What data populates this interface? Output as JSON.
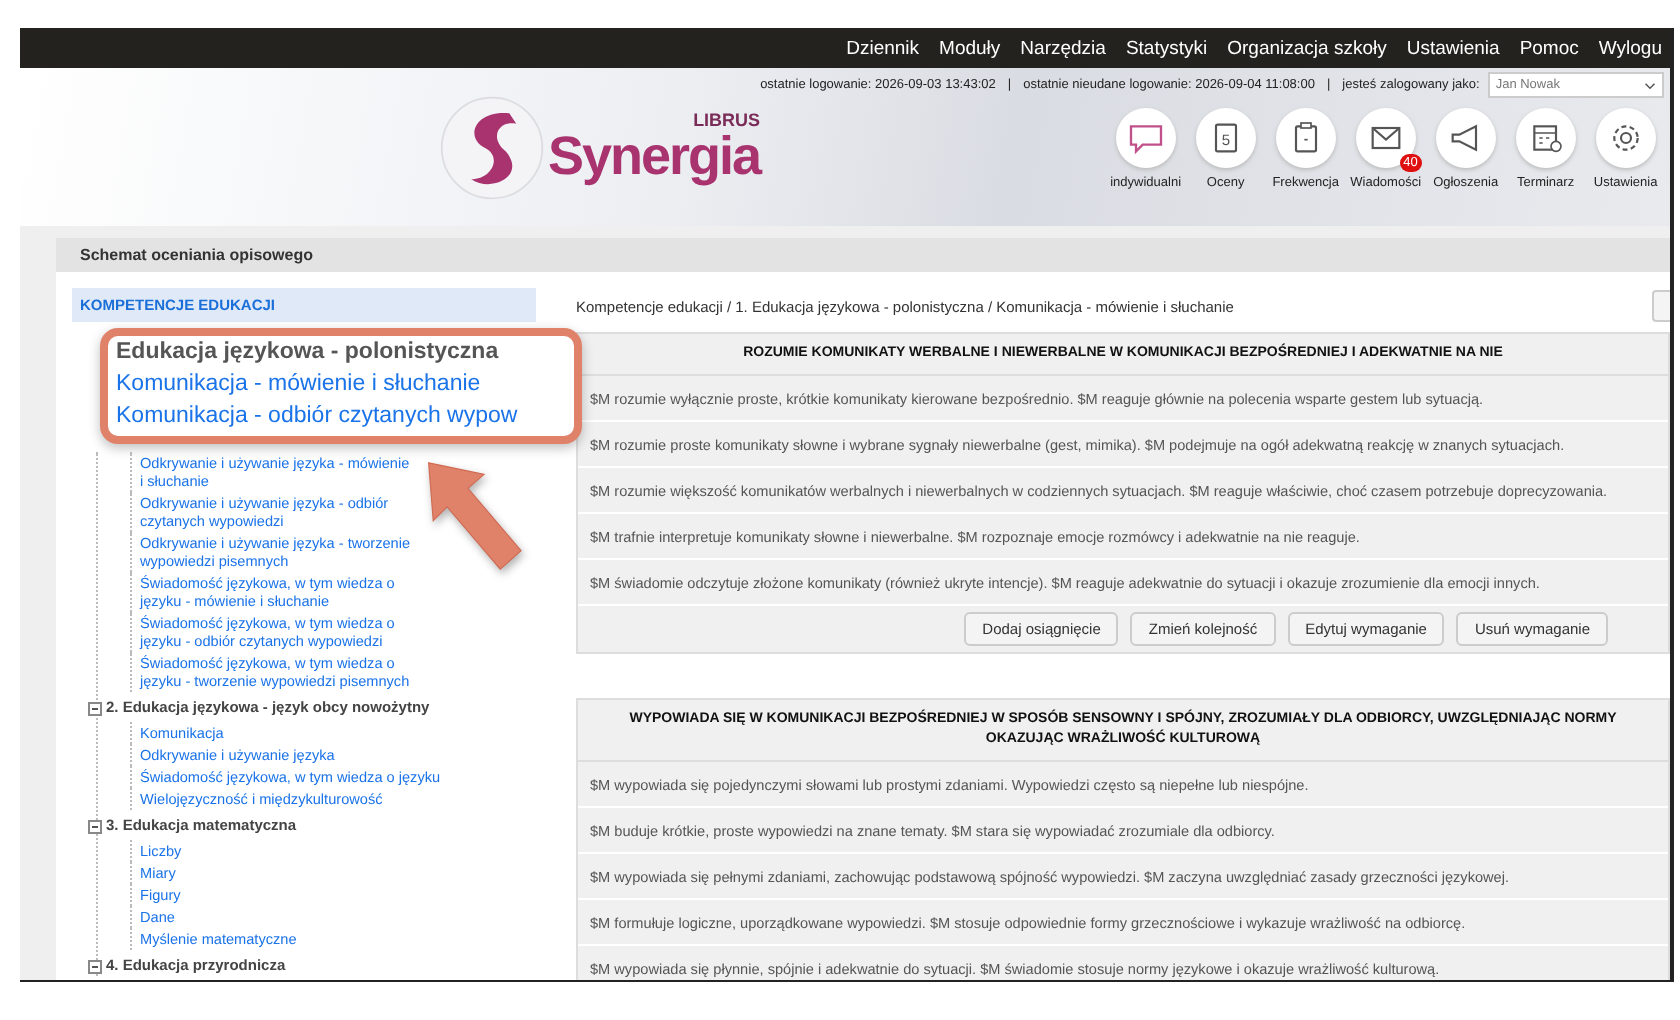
{
  "top_menu": [
    "Dziennik",
    "Moduły",
    "Narzędzia",
    "Statystyki",
    "Organizacja szkoły",
    "Ustawienia",
    "Pomoc",
    "Wylogu"
  ],
  "login_info": {
    "last_login": "ostatnie logowanie: 2026-09-03 13:43:02",
    "separator_1": "|",
    "last_failed": "ostatnie nieudane logowanie: 2026-09-04 11:08:00",
    "separator_2": "|",
    "logged_as": "jesteś zalogowany jako:",
    "user": "Jan Nowak"
  },
  "logo": {
    "small": "LIBRUS",
    "name": "Synergia"
  },
  "quick_icons": [
    {
      "kind": "chat",
      "label": "indywidualni"
    },
    {
      "kind": "grade",
      "label": "Oceny",
      "glyph": "5"
    },
    {
      "kind": "clipboard",
      "label": "Frekwencja"
    },
    {
      "kind": "mail",
      "label": "Wiadomości",
      "badge": "40"
    },
    {
      "kind": "megaphone",
      "label": "Ogłoszenia"
    },
    {
      "kind": "calendar",
      "label": "Terminarz"
    },
    {
      "kind": "gear",
      "label": "Ustawienia"
    }
  ],
  "panel": {
    "title": "Schemat oceniania opisowego"
  },
  "tree": {
    "header": "KOMPETENCJE EDUKACJI",
    "callout": {
      "lines": [
        "Edukacja językowa - polonistyczna",
        "Komunikacja - mówienie i słuchanie",
        "Komunikacja - odbiór czytanych wypow"
      ]
    },
    "groups": [
      {
        "children": [
          "Odkrywanie i używanie języka - mówienie i słuchanie",
          "Odkrywanie i używanie języka - odbiór czytanych wypowiedzi",
          "Odkrywanie i używanie języka - tworzenie wypowiedzi pisemnych",
          "Świadomość językowa, w tym wiedza o języku - mówienie i słuchanie",
          "Świadomość językowa, w tym wiedza o języku - odbiór czytanych wypowiedzi",
          "Świadomość językowa, w tym wiedza o języku - tworzenie wypowiedzi pisemnych"
        ]
      },
      {
        "title": "2. Edukacja językowa - język obcy nowożytny",
        "expanded": true,
        "children": [
          "Komunikacja",
          "Odkrywanie i używanie języka",
          "Świadomość językowa, w tym wiedza o języku",
          "Wielojęzyczność i międzykulturowość"
        ]
      },
      {
        "title": "3. Edukacja matematyczna",
        "expanded": true,
        "children": [
          "Liczby",
          "Miary",
          "Figury",
          "Dane",
          "Myślenie matematyczne"
        ]
      },
      {
        "title": "4. Edukacja przyrodnicza",
        "expanded": true
      }
    ]
  },
  "breadcrumb": "Kompetencje edukacji / 1. Edukacja językowa - polonistyczna / Komunikacja - mówienie i słuchanie",
  "tables": [
    {
      "title_lines": [
        "ROZUMIE KOMUNIKATY WERBALNE I NIEWERBALNE W KOMUNIKACJI BEZPOŚREDNIEJ I ADEKWATNIE NA NIE"
      ],
      "rows": [
        "$M rozumie wyłącznie proste, krótkie komunikaty kierowane bezpośrednio. $M reaguje głównie na polecenia wsparte gestem lub sytuacją.",
        "$M rozumie proste komunikaty słowne i wybrane sygnały niewerbalne (gest, mimika). $M podejmuje na ogół adekwatną reakcję w znanych sytuacjach.",
        "$M rozumie większość komunikatów werbalnych i niewerbalnych w codziennych sytuacjach. $M reaguje właściwie, choć czasem potrzebuje doprecyzowania.",
        "$M trafnie interpretuje komunikaty słowne i niewerbalne. $M rozpoznaje emocje rozmówcy i adekwatnie na nie reaguje.",
        "$M świadomie odczytuje złożone komunikaty (również ukryte intencje). $M reaguje adekwatnie do sytuacji i okazuje zrozumienie dla emocji innych."
      ],
      "buttons": [
        "Dodaj osiągnięcie",
        "Zmień kolejność",
        "Edytuj wymaganie",
        "Usuń wymaganie"
      ]
    },
    {
      "title_lines": [
        "WYPOWIADA SIĘ W KOMUNIKACJI BEZPOŚREDNIEJ W SPOSÓB SENSOWNY I SPÓJNY, ZROZUMIAŁY DLA ODBIORCY, UWZGLĘDNIAJĄC NORMY",
        "OKAZUJĄC WRAŻLIWOŚĆ KULTUROWĄ"
      ],
      "rows": [
        "$M wypowiada się pojedynczymi słowami lub prostymi zdaniami. Wypowiedzi często są niepełne lub niespójne.",
        "$M buduje krótkie, proste wypowiedzi na znane tematy. $M stara się wypowiadać zrozumiale dla odbiorcy.",
        "$M wypowiada się pełnymi zdaniami, zachowując podstawową spójność wypowiedzi. $M zaczyna uwzględniać zasady grzeczności językowej.",
        "$M formułuje logiczne, uporządkowane wypowiedzi. $M stosuje odpowiednie formy grzecznościowe i wykazuje wrażliwość na odbiorcę.",
        "$M wypowiada się płynnie, spójnie i adekwatnie do sytuacji. $M świadomie stosuje normy językowe i okazuje wrażliwość kulturową."
      ]
    }
  ]
}
